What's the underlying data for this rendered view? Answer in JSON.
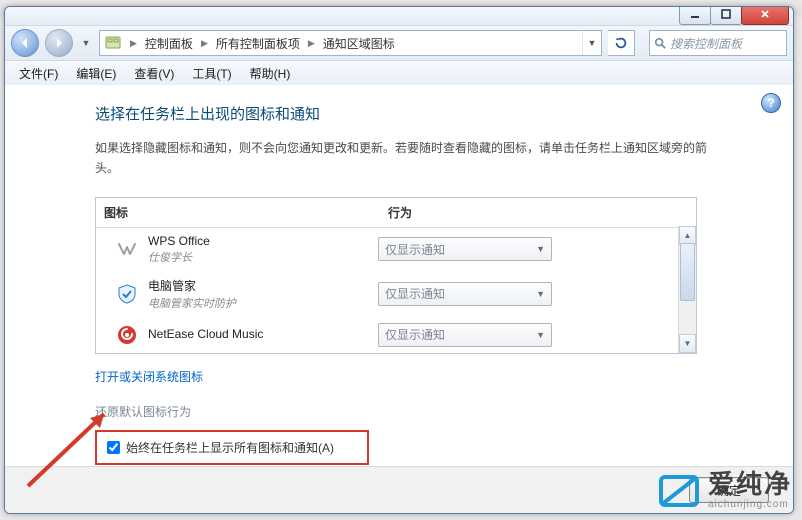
{
  "window": {
    "min_tip": "最小化",
    "max_tip": "最大化",
    "close_tip": "关闭"
  },
  "breadcrumb": {
    "root_icon": "control-panel-icon",
    "items": [
      "控制面板",
      "所有控制面板项",
      "通知区域图标"
    ]
  },
  "search": {
    "placeholder": "搜索控制面板"
  },
  "menubar": {
    "file": "文件(F)",
    "edit": "编辑(E)",
    "view": "查看(V)",
    "tools": "工具(T)",
    "help": "帮助(H)"
  },
  "page": {
    "heading": "选择在任务栏上出现的图标和通知",
    "description": "如果选择隐藏图标和通知，则不会向您通知更改和更新。若要随时查看隐藏的图标，请单击任务栏上通知区域旁的箭头。",
    "col_icon": "图标",
    "col_behavior": "行为",
    "rows": [
      {
        "name": "WPS Office",
        "sub": "仕俊学长",
        "behavior": "仅显示通知",
        "icon": "wps-icon"
      },
      {
        "name": "电脑管家",
        "sub": "电脑管家实时防护",
        "behavior": "仅显示通知",
        "icon": "shield-icon"
      },
      {
        "name": "NetEase Cloud Music",
        "sub": "",
        "behavior": "仅显示通知",
        "icon": "netease-icon"
      }
    ],
    "link_system_icons": "打开或关闭系统图标",
    "restore_default": "还原默认图标行为",
    "always_show_label": "始终在任务栏上显示所有图标和通知(A)",
    "always_show_checked": true,
    "ok_label": "确定"
  },
  "watermark": {
    "brand_zh": "爱纯净",
    "brand_en": "aichunjing.com"
  }
}
